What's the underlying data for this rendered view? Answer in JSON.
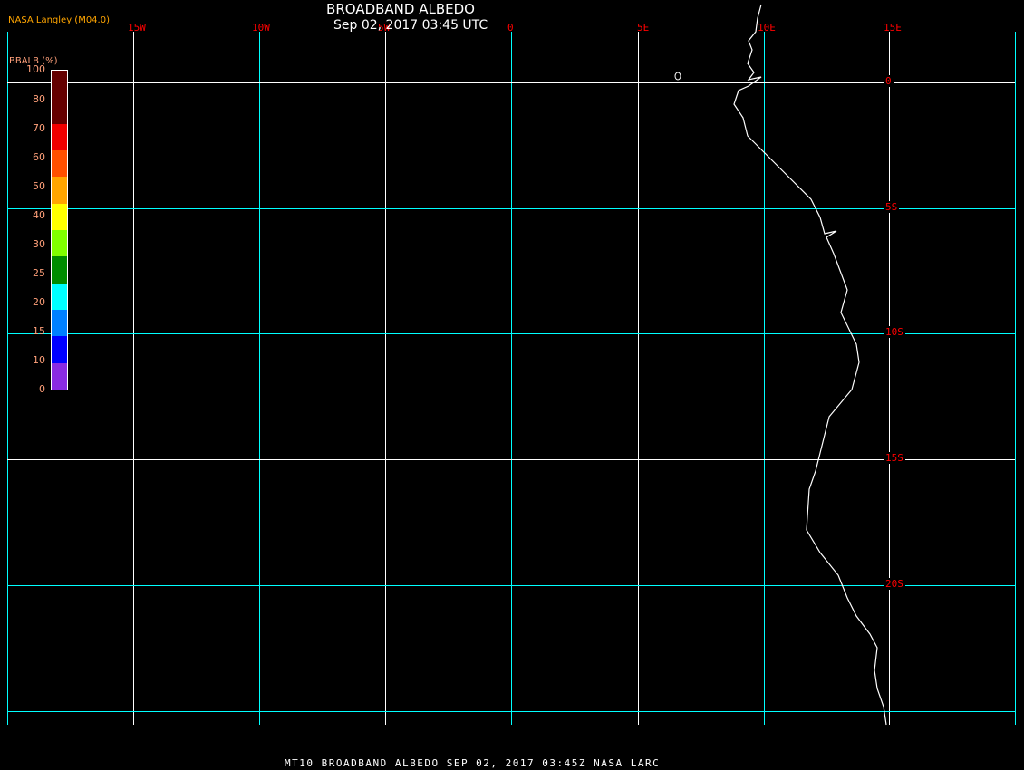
{
  "header": {
    "title": "BROADBAND ALBEDO",
    "datetime": "Sep 02, 2017 03:45 UTC",
    "credit": "NASA Langley (M04.0)"
  },
  "footer": "MT10   BROADBAND ALBEDO   SEP 02, 2017 03:45Z   NASA LARC",
  "map": {
    "longitude_labels": [
      "15W",
      "10W",
      "5W",
      "0",
      "5E",
      "10E",
      "15E"
    ],
    "latitude_labels": [
      "0",
      "5S",
      "10S",
      "15S",
      "20S"
    ],
    "grid_color_major": "#00ffff",
    "grid_color_minor": "#ffffff",
    "coastline_color": "#ffffff",
    "label_color": "#ff0000"
  },
  "legend": {
    "title": "BBALB (%)",
    "ticks": [
      "100",
      "80",
      "70",
      "60",
      "50",
      "40",
      "30",
      "25",
      "20",
      "15",
      "10",
      "0"
    ],
    "colors": [
      "#640000",
      "#640000",
      "#f00000",
      "#ff5000",
      "#ffa500",
      "#ffff00",
      "#80ff00",
      "#008c00",
      "#00ffff",
      "#0080ff",
      "#0000ff",
      "#8a2be2"
    ]
  }
}
